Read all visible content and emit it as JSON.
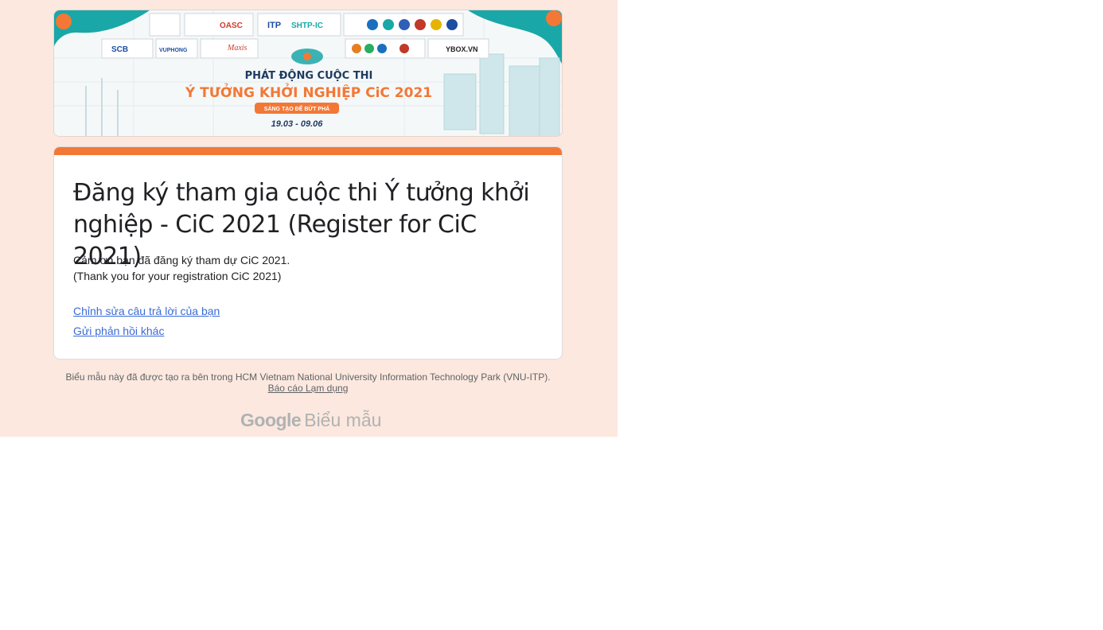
{
  "banner": {
    "logos_row1": [
      "OASC",
      "ITP",
      "SHTP-IC"
    ],
    "logos_row2": [
      "SCB",
      "VUPHONG",
      "Maxis",
      "YBOX.VN"
    ],
    "headline": "PHÁT ĐỘNG CUỘC THI",
    "title": "Ý TƯỞNG KHỞI NGHIỆP CiC 2021",
    "slogan": "SÁNG TẠO ĐỂ BỨT PHÁ",
    "dates": "19.03 - 09.06"
  },
  "form": {
    "title": "Đăng ký tham gia cuộc thi Ý tưởng khởi nghiệp - CiC 2021 (Register for CiC 2021)",
    "message_vi": "Cảm ơn bạn đã đăng ký tham dự CiC 2021.",
    "message_en": "(Thank you for your registration CiC 2021)",
    "edit_link": "Chỉnh sửa câu trả lời của bạn",
    "another_link": "Gửi phản hồi khác"
  },
  "footer": {
    "notice": "Biểu mẫu này đã được tạo ra bên trong HCM Vietnam National University Information Technology Park (VNU-ITP).",
    "report": "Báo cáo Lạm dụng",
    "brand_google": "Google",
    "brand_forms": "Biểu mẫu"
  },
  "colors": {
    "page_bg": "#fce8de",
    "accent": "#f37836",
    "link": "#3b6bd6",
    "banner_teal": "#1aa7a8"
  }
}
